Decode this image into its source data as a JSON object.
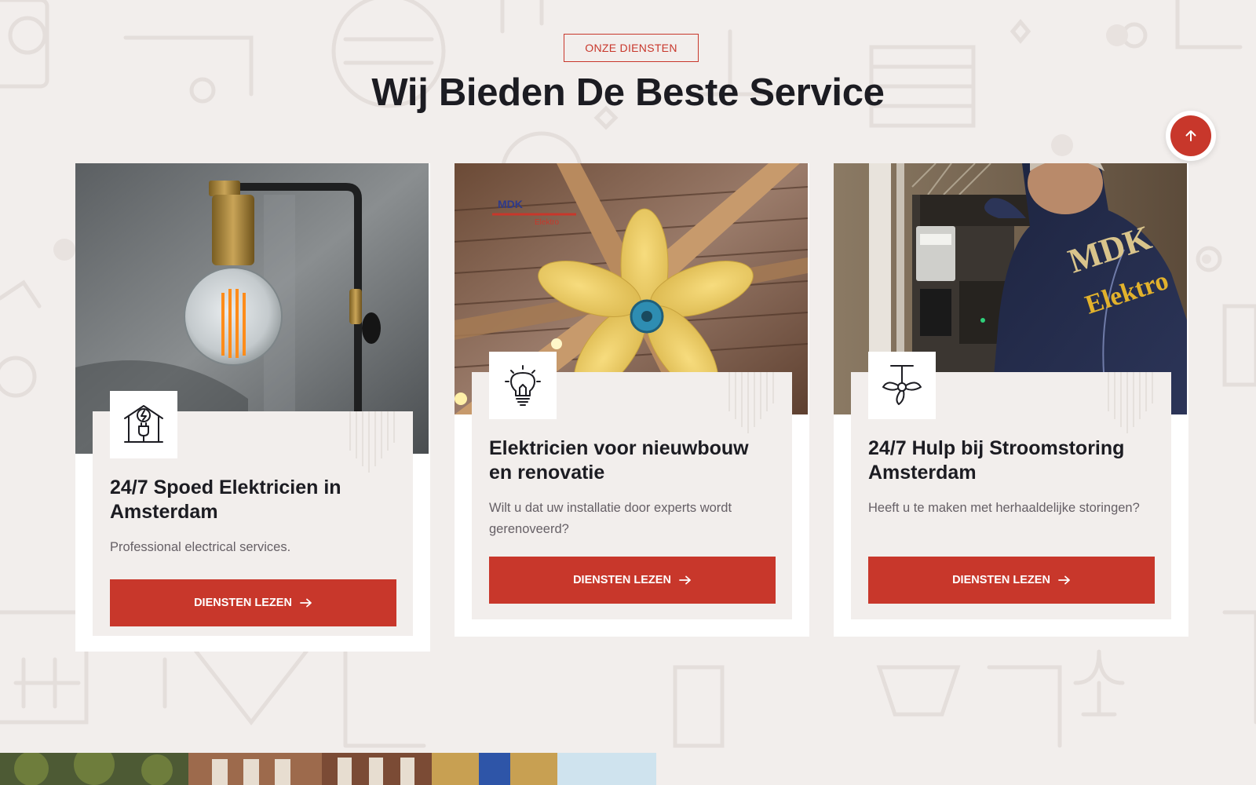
{
  "section": {
    "eyebrow": "ONZE DIENSTEN",
    "title": "Wij Bieden De Beste Service"
  },
  "scroll_top": {
    "icon": "arrow-up-icon"
  },
  "cards": [
    {
      "image": "lightbulb-wall-lamp-photo",
      "icon": "house-plug-icon",
      "title": "24/7 Spoed Elektricien in Amsterdam",
      "text": "Professional electrical services.",
      "button": "DIENSTEN LEZEN"
    },
    {
      "image": "ceiling-fan-photo",
      "icon": "lightbulb-icon",
      "title": "Elektricien voor nieuwbouw en renovatie",
      "text": "Wilt u dat uw installatie door experts wordt gerenoveerd?",
      "button": "DIENSTEN LEZEN"
    },
    {
      "image": "electrician-at-fuse-box-photo",
      "icon": "ceiling-fan-icon",
      "title": "24/7 Hulp bij Stroomstoring Amsterdam",
      "text": "Heeft u te maken met herhaaldelijke storingen?",
      "button": "DIENSTEN LEZEN"
    }
  ],
  "image_logo": {
    "line1": "MDK",
    "line2": "Elektro"
  },
  "jacket_logo": {
    "line1": "MDK",
    "line2": "Elektro"
  },
  "colors": {
    "accent": "#c8372b",
    "background": "#f2eeec",
    "heading": "#1c1c22",
    "body_text": "#666066"
  }
}
